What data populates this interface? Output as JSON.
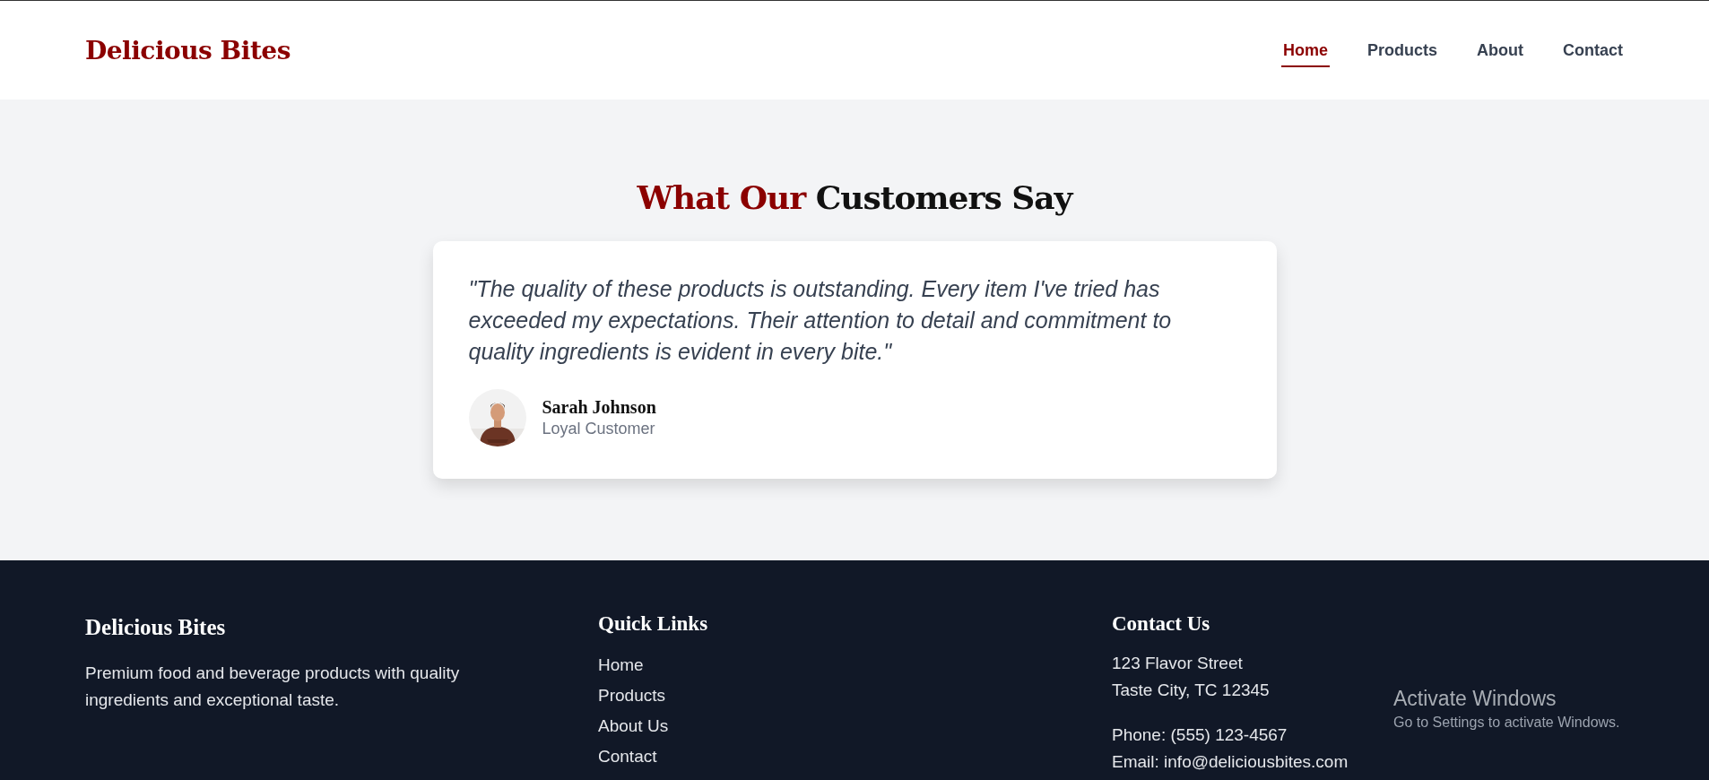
{
  "header": {
    "logo": "Delicious Bites",
    "nav": [
      {
        "label": "Home",
        "selected": true
      },
      {
        "label": "Products",
        "selected": false
      },
      {
        "label": "About",
        "selected": false
      },
      {
        "label": "Contact",
        "selected": false
      }
    ]
  },
  "testimonials": {
    "title": [
      {
        "text": "What Our",
        "accent": true
      },
      {
        "text": "Customers Say",
        "accent": false
      }
    ],
    "card": {
      "quote": "\"The quality of these products is outstanding. Every item I've tried has exceeded my expectations. Their attention to detail and commitment to quality ingredients is evident in every bite.\"",
      "name": "Sarah Johnson",
      "role": "Loyal Customer"
    }
  },
  "footer": {
    "brand": {
      "title": "Delicious Bites",
      "text": "Premium food and beverage products with quality ingredients and exceptional taste."
    },
    "quick_links": {
      "title": "Quick Links",
      "links": [
        "Home",
        "Products",
        "About Us",
        "Contact"
      ]
    },
    "contact": {
      "title": "Contact Us",
      "address": [
        "123 Flavor Street",
        "Taste City, TC 12345"
      ],
      "lines": [
        "Phone: (555) 123-4567",
        "Email: info@deliciousbites.com"
      ]
    }
  },
  "os_notice": {
    "title": "Activate Windows",
    "subtitle": "Go to Settings to activate Windows."
  }
}
